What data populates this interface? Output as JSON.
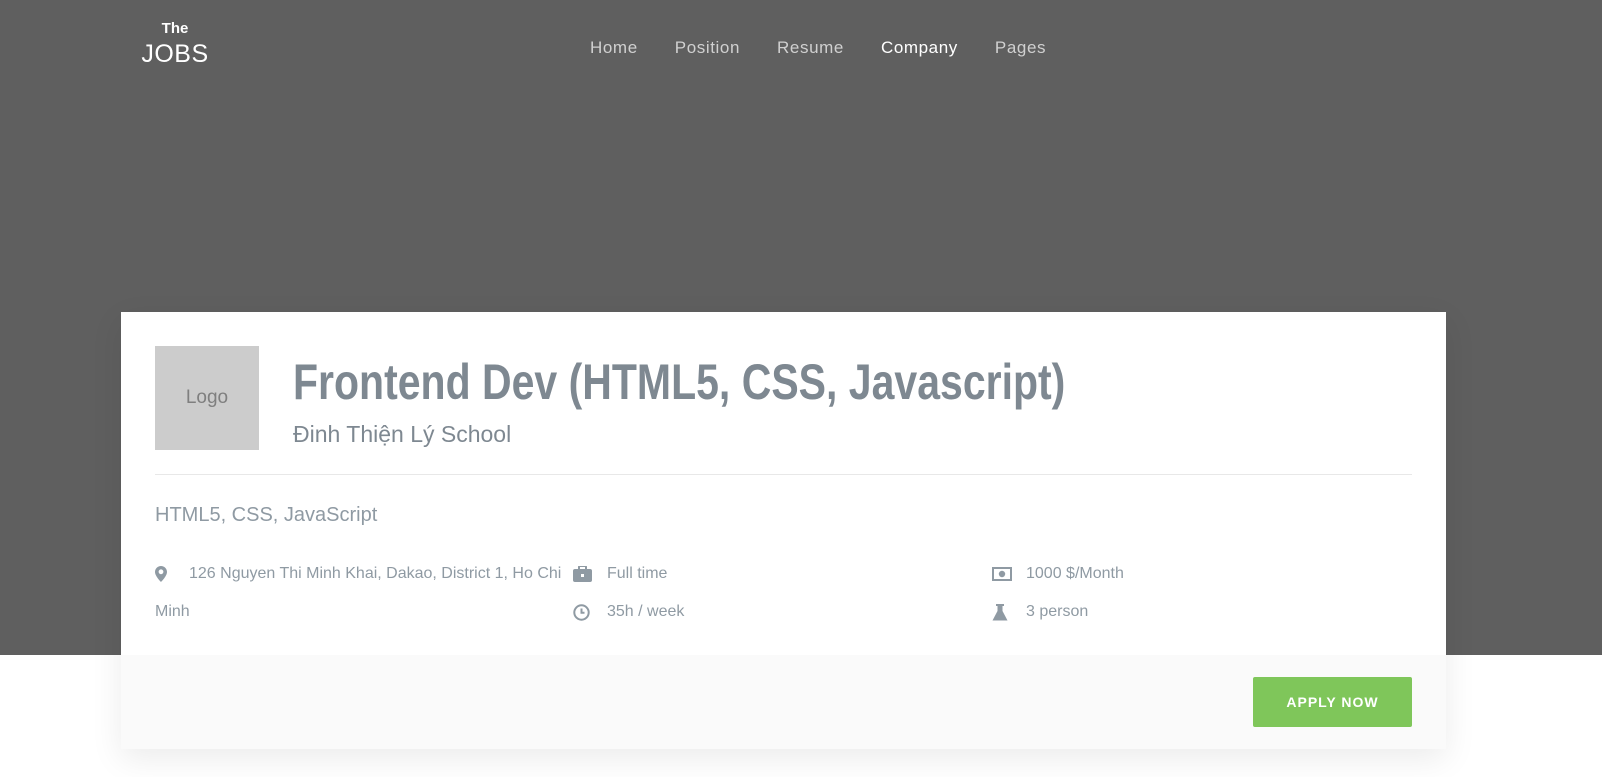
{
  "brand": {
    "line1": "The",
    "line2": "JOBS"
  },
  "nav": {
    "items": [
      {
        "label": "Home",
        "active": false
      },
      {
        "label": "Position",
        "active": false
      },
      {
        "label": "Resume",
        "active": false
      },
      {
        "label": "Company",
        "active": true
      },
      {
        "label": "Pages",
        "active": false
      }
    ]
  },
  "job": {
    "logo_text": "Logo",
    "title": "Frontend Dev (HTML5, CSS, Javascript)",
    "company": "Đinh Thiện Lý School",
    "skills": "HTML5, CSS, JavaScript",
    "address_line1": "126 Nguyen Thi Minh Khai, Dakao, District 1, Ho Chi",
    "address_line2": "Minh",
    "employment_type": "Full time",
    "hours": "35h / week",
    "salary": "1000 $/Month",
    "headcount": "3 person",
    "apply_label": "APPLY NOW"
  },
  "colors": {
    "hero_bg": "#5f5f5f",
    "accent": "#7fc65a",
    "text_muted": "#8f9aa3",
    "title": "#7e8891"
  },
  "icons": {
    "address": "map-pin-icon",
    "type": "briefcase-icon",
    "hours": "clock-icon",
    "salary": "money-icon",
    "headcount": "flask-icon"
  }
}
